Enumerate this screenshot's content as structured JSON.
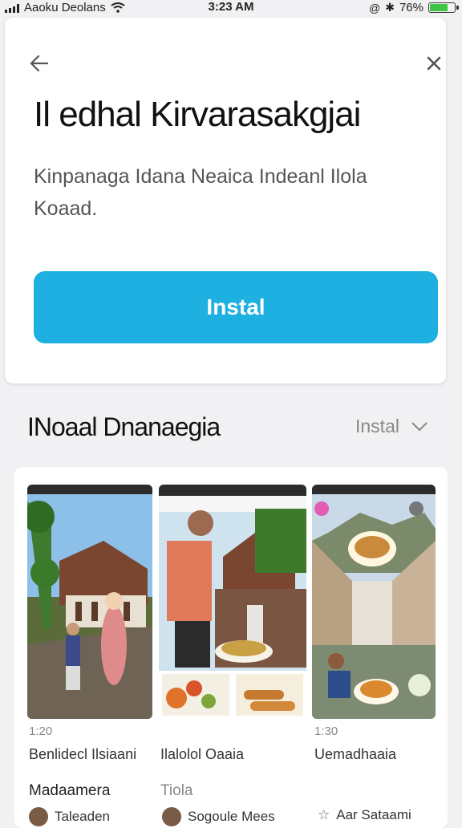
{
  "status_bar": {
    "carrier": "Aaoku Deolans",
    "time": "3:23 AM",
    "battery": "76%",
    "battery_level": 0.76,
    "battery_color": "#3fc444"
  },
  "install_card": {
    "back_icon": "arrow-left-icon",
    "close_icon": "close-x-icon",
    "title": "Il edhal  Kirvarasakgjai",
    "description": "Kinpanaga Idana Neaica Indeanl Ilola Koaad.",
    "install_label": "Instal",
    "accent_color": "#1fb0e2"
  },
  "screenshots_section": {
    "title": "INoaal Dnanaegia",
    "action_label": "Instal",
    "action_icon": "chevron-down-icon",
    "items": [
      {
        "size": "1:20",
        "name": "Benlidecl Ilsiaani"
      },
      {
        "size": "",
        "name": "Ilalolol Oaaia"
      },
      {
        "size": "1:30",
        "name": "Uemadhaaia"
      }
    ]
  },
  "more_section": {
    "title": "Madaamera",
    "link": "Tiola",
    "people": [
      {
        "name": "Taleaden"
      },
      {
        "name": "Sogoule Mees"
      },
      {
        "name": "Aar Sataami"
      }
    ]
  }
}
